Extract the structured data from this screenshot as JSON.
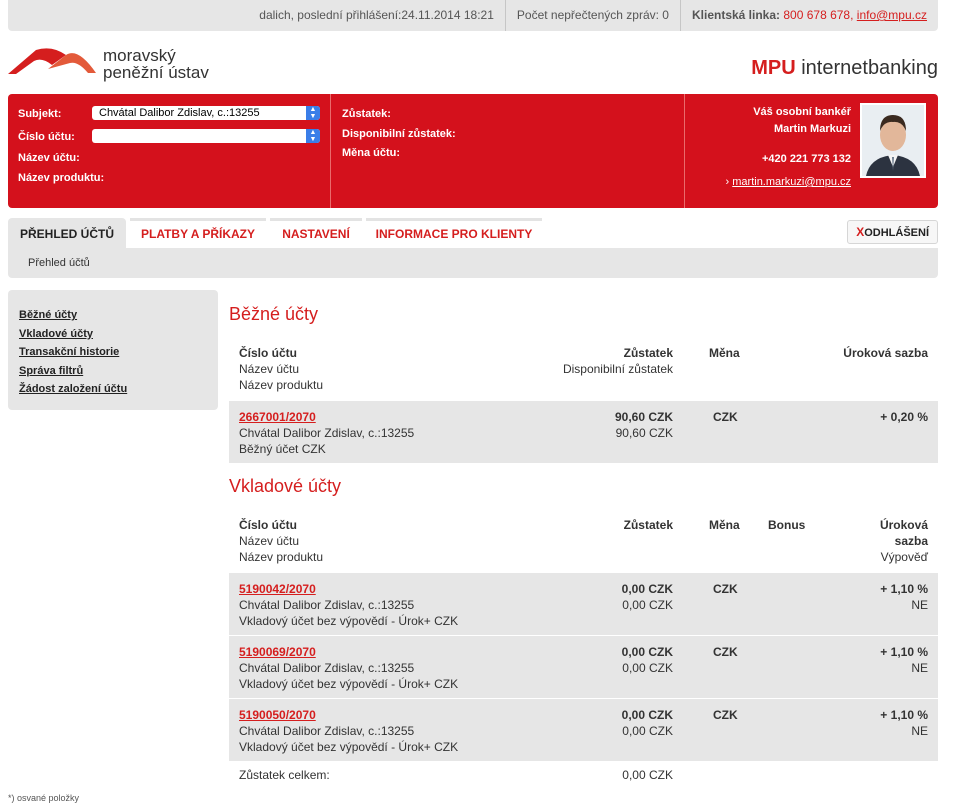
{
  "topbar": {
    "last_login": "dalich, poslední přihlášení:24.11.2014 18:21",
    "unread": "Počet nepřečtených zpráv: 0",
    "hotline_label": "Klientská linka:",
    "hotline_phone": "800 678 678,",
    "hotline_email": "info@mpu.cz"
  },
  "header": {
    "logo_line1": "moravský",
    "logo_line2": "peněžní ústav",
    "brand_bold": "MPU",
    "brand_rest": " internetbanking"
  },
  "client_panel": {
    "subject_label": "Subjekt:",
    "subject_value": "Chvátal Dalibor Zdislav, c.:13255",
    "account_number_label": "Číslo účtu:",
    "account_number_value": "",
    "account_name_label": "Název účtu:",
    "product_name_label": "Název produktu:",
    "balance_label": "Zůstatek:",
    "available_balance_label": "Disponibilní zůstatek:",
    "currency_label": "Měna účtu:",
    "banker_title": "Váš osobní bankéř",
    "banker_name": "Martin Markuzi",
    "banker_phone": "+420 221 773 132",
    "banker_email": "martin.markuzi@mpu.cz"
  },
  "tabs": [
    {
      "label": "PŘEHLED ÚČTŮ",
      "active": true
    },
    {
      "label": "PLATBY A PŘÍKAZY",
      "active": false
    },
    {
      "label": "NASTAVENÍ",
      "active": false
    },
    {
      "label": "INFORMACE PRO KLIENTY",
      "active": false
    }
  ],
  "logout": {
    "x": "X",
    "label": "ODHLÁŠENÍ"
  },
  "breadcrumb": "Přehled účtů",
  "sidebar": [
    "Běžné účty",
    "Vkladové účty",
    "Transakční historie",
    "Správa filtrů",
    "Žádost založení účtu"
  ],
  "current_accounts": {
    "title": "Běžné účty",
    "header": {
      "col1_l1": "Číslo účtu",
      "col1_l2": "Název účtu",
      "col1_l3": "Název produktu",
      "balance": "Zůstatek",
      "available": "Disponibilní zůstatek",
      "currency": "Měna",
      "rate": "Úroková sazba"
    },
    "rows": [
      {
        "number": "2667001/2070",
        "name": "Chvátal Dalibor Zdislav, c.:13255",
        "product": "Běžný účet CZK",
        "balance": "90,60 CZK",
        "available": "90,60 CZK",
        "currency": "CZK",
        "rate": "+ 0,20 %"
      }
    ]
  },
  "deposit_accounts": {
    "title": "Vkladové účty",
    "header": {
      "col1_l1": "Číslo účtu",
      "col1_l2": "Název účtu",
      "col1_l3": "Název produktu",
      "balance": "Zůstatek",
      "currency": "Měna",
      "bonus": "Bonus",
      "rate_l1": "Úroková",
      "rate_l2": "sazba",
      "rate_l3": "Výpověď"
    },
    "rows": [
      {
        "number": "5190042/2070",
        "name": "Chvátal Dalibor Zdislav, c.:13255",
        "product": "Vkladový účet bez výpovědí - Úrok+ CZK",
        "balance": "0,00 CZK",
        "available": "0,00 CZK",
        "currency": "CZK",
        "rate": "+ 1,10 %",
        "notice": "NE"
      },
      {
        "number": "5190069/2070",
        "name": "Chvátal Dalibor Zdislav, c.:13255",
        "product": "Vkladový účet bez výpovědí - Úrok+ CZK",
        "balance": "0,00 CZK",
        "available": "0,00 CZK",
        "currency": "CZK",
        "rate": "+ 1,10 %",
        "notice": "NE"
      },
      {
        "number": "5190050/2070",
        "name": "Chvátal Dalibor Zdislav, c.:13255",
        "product": "Vkladový účet bez výpovědí - Úrok+ CZK",
        "balance": "0,00 CZK",
        "available": "0,00 CZK",
        "currency": "CZK",
        "rate": "+ 1,10 %",
        "notice": "NE"
      }
    ],
    "total_label": "Zůstatek celkem:",
    "total_value": "0,00 CZK"
  },
  "footnote": "*) osvané položky"
}
